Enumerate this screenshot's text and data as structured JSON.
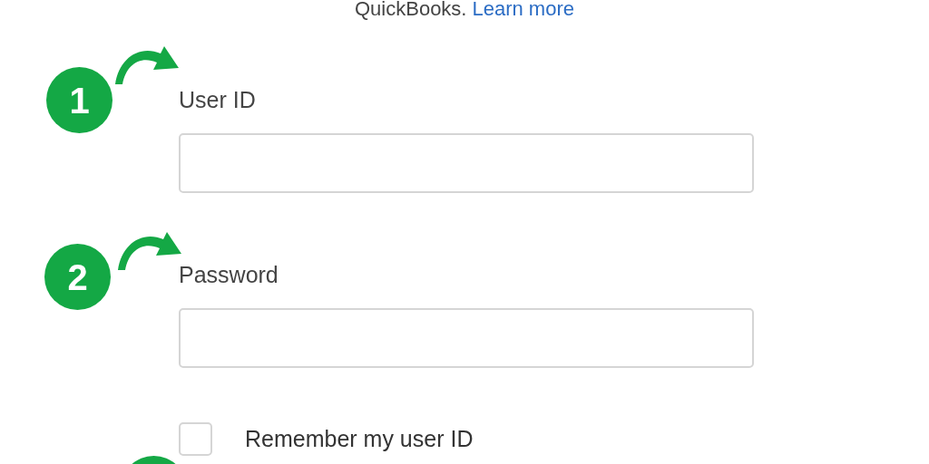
{
  "intro": {
    "text": "QuickBooks.",
    "link": "Learn more"
  },
  "fields": [
    {
      "label": "User ID"
    },
    {
      "label": "Password"
    }
  ],
  "remember": {
    "label": "Remember my user ID",
    "checked": false
  },
  "steps": [
    {
      "number": "1",
      "arrow": true
    },
    {
      "number": "2",
      "arrow": true
    },
    {
      "arrow": false
    }
  ]
}
